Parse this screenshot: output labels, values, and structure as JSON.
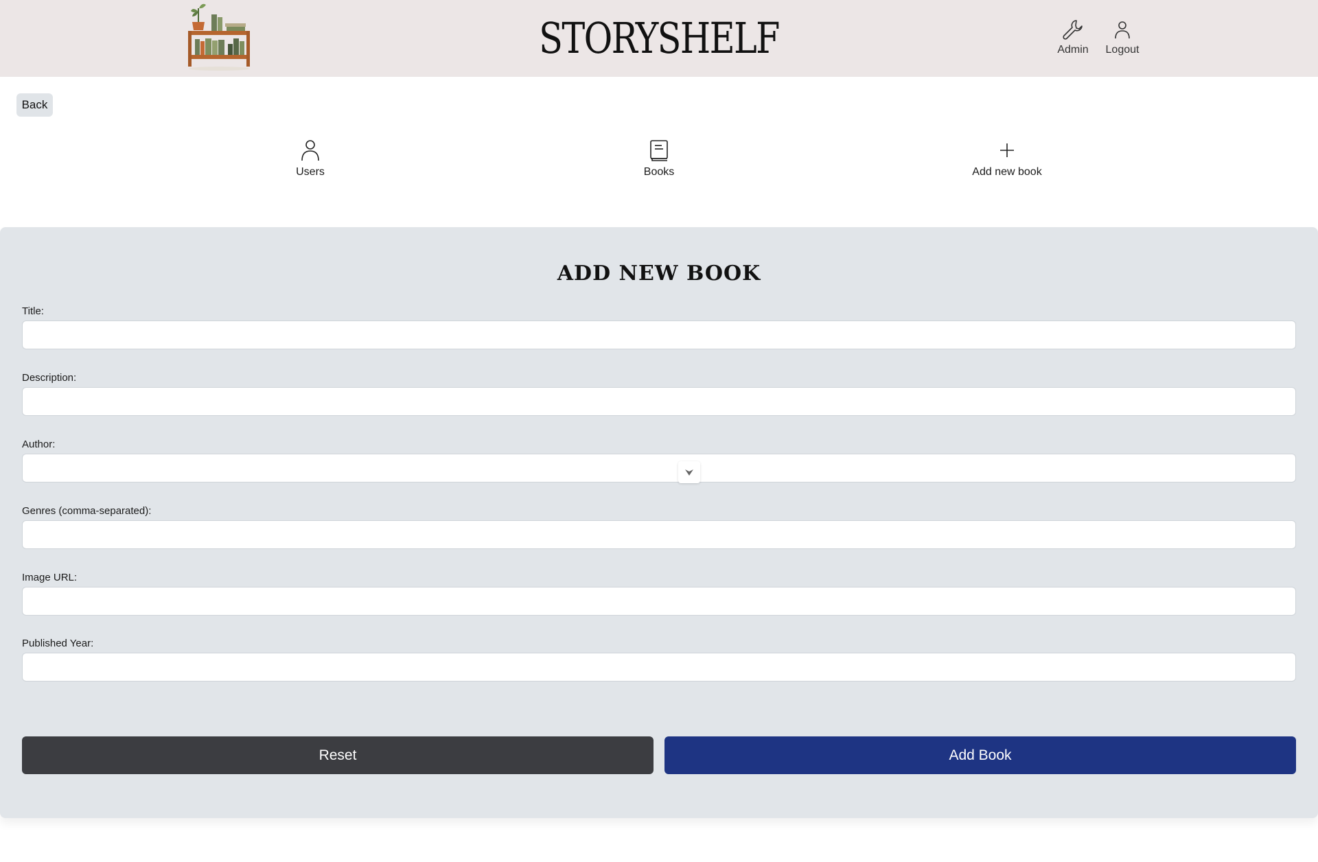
{
  "header": {
    "brand": "STORYSHELF",
    "logo_icon": "bookshelf-logo",
    "admin_label": "Admin",
    "admin_icon": "wrench-icon",
    "logout_label": "Logout",
    "logout_icon": "user-icon",
    "background_color": "#ece6e6"
  },
  "back_label": "Back",
  "nav": {
    "items": [
      {
        "label": "Users",
        "icon": "user-icon"
      },
      {
        "label": "Books",
        "icon": "book-icon"
      },
      {
        "label": "Add new book",
        "icon": "plus-icon"
      }
    ]
  },
  "form": {
    "title": "ADD NEW BOOK",
    "fields": [
      {
        "label": "Title:",
        "value": ""
      },
      {
        "label": "Description:",
        "value": ""
      },
      {
        "label": "Author:",
        "value": ""
      },
      {
        "label": "Genres (comma-separated):",
        "value": ""
      },
      {
        "label": "Image URL:",
        "value": ""
      },
      {
        "label": "Published Year:",
        "value": ""
      }
    ],
    "reset_label": "Reset",
    "submit_label": "Add Book",
    "panel_color": "#e1e5e9",
    "reset_color": "#3c3d41",
    "submit_color": "#1e3483"
  }
}
